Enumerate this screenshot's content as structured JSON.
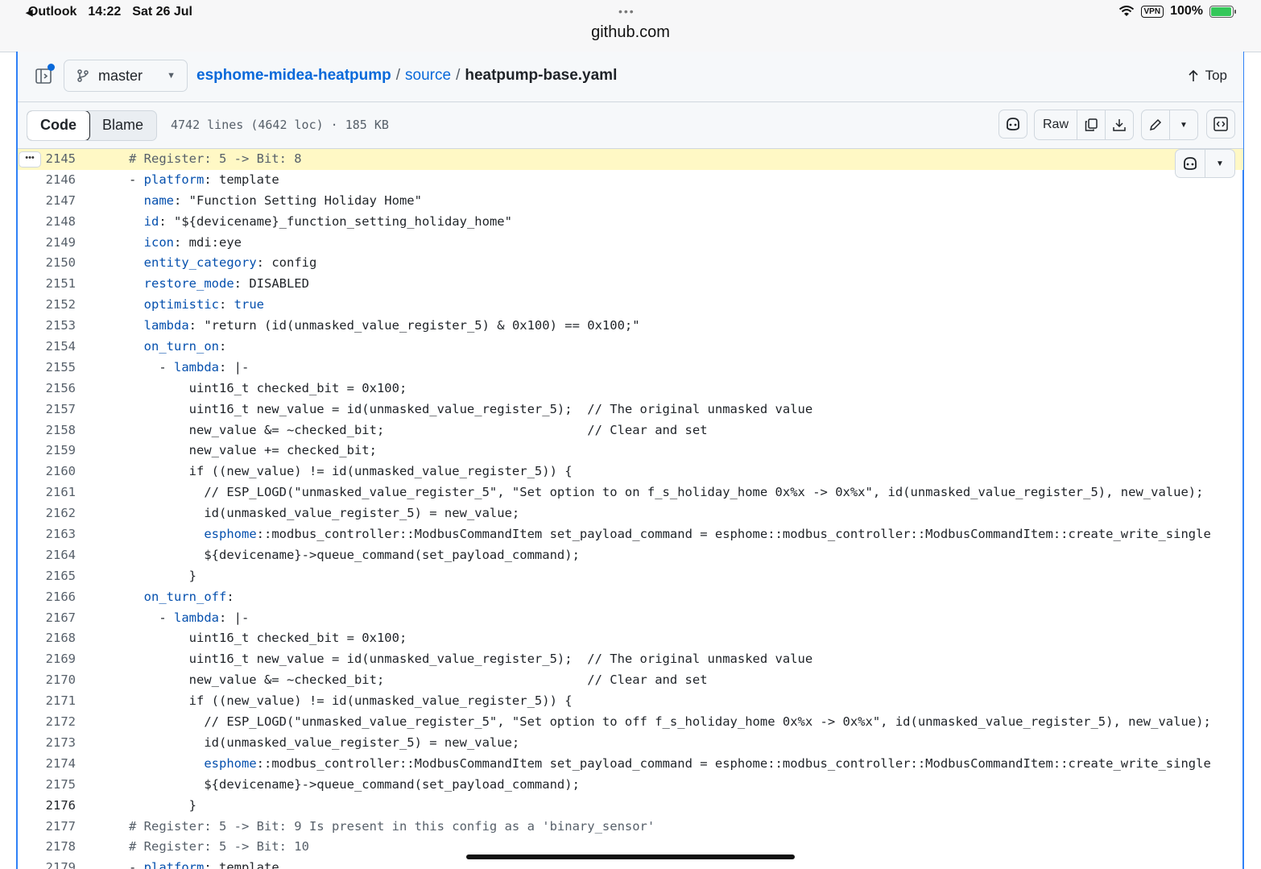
{
  "status_bar": {
    "back_app": "Outlook",
    "time": "14:22",
    "date": "Sat 26 Jul",
    "vpn": "VPN",
    "battery": "100%",
    "url": "github.com"
  },
  "header": {
    "branch": "master",
    "repo": "esphome-midea-heatpump",
    "folder": "source",
    "file": "heatpump-base.yaml",
    "top_label": "Top"
  },
  "toolbar": {
    "tab_code": "Code",
    "tab_blame": "Blame",
    "file_info": "4742 lines (4642 loc) · 185 KB",
    "raw_label": "Raw"
  },
  "code_lines": [
    {
      "n": "2145",
      "t": "# Register: 5 -> Bit: 8"
    },
    {
      "n": "2146",
      "t": "- platform: template"
    },
    {
      "n": "2147",
      "t": "  name: \"Function Setting Holiday Home\""
    },
    {
      "n": "2148",
      "t": "  id: \"${devicename}_function_setting_holiday_home\""
    },
    {
      "n": "2149",
      "t": "  icon: mdi:eye"
    },
    {
      "n": "2150",
      "t": "  entity_category: config"
    },
    {
      "n": "2151",
      "t": "  restore_mode: DISABLED"
    },
    {
      "n": "2152",
      "t": "  optimistic: true"
    },
    {
      "n": "2153",
      "t": "  lambda: \"return (id(unmasked_value_register_5) & 0x100) == 0x100;\""
    },
    {
      "n": "2154",
      "t": "  on_turn_on:"
    },
    {
      "n": "2155",
      "t": "    - lambda: |-"
    },
    {
      "n": "2156",
      "t": "        uint16_t checked_bit = 0x100;"
    },
    {
      "n": "2157",
      "t": "        uint16_t new_value = id(unmasked_value_register_5);  // The original unmasked value"
    },
    {
      "n": "2158",
      "t": "        new_value &= ~checked_bit;                           // Clear and set"
    },
    {
      "n": "2159",
      "t": "        new_value += checked_bit;"
    },
    {
      "n": "2160",
      "t": "        if ((new_value) != id(unmasked_value_register_5)) {"
    },
    {
      "n": "2161",
      "t": "          // ESP_LOGD(\"unmasked_value_register_5\", \"Set option to on f_s_holiday_home 0x%x -> 0x%x\", id(unmasked_value_register_5), new_value);"
    },
    {
      "n": "2162",
      "t": "          id(unmasked_value_register_5) = new_value;"
    },
    {
      "n": "2163",
      "t": "          esphome::modbus_controller::ModbusCommandItem set_payload_command = esphome::modbus_controller::ModbusCommandItem::create_write_single"
    },
    {
      "n": "2164",
      "t": "          ${devicename}->queue_command(set_payload_command);"
    },
    {
      "n": "2165",
      "t": "        }"
    },
    {
      "n": "2166",
      "t": "  on_turn_off:"
    },
    {
      "n": "2167",
      "t": "    - lambda: |-"
    },
    {
      "n": "2168",
      "t": "        uint16_t checked_bit = 0x100;"
    },
    {
      "n": "2169",
      "t": "        uint16_t new_value = id(unmasked_value_register_5);  // The original unmasked value"
    },
    {
      "n": "2170",
      "t": "        new_value &= ~checked_bit;                           // Clear and set"
    },
    {
      "n": "2171",
      "t": "        if ((new_value) != id(unmasked_value_register_5)) {"
    },
    {
      "n": "2172",
      "t": "          // ESP_LOGD(\"unmasked_value_register_5\", \"Set option to off f_s_holiday_home 0x%x -> 0x%x\", id(unmasked_value_register_5), new_value);"
    },
    {
      "n": "2173",
      "t": "          id(unmasked_value_register_5) = new_value;"
    },
    {
      "n": "2174",
      "t": "          esphome::modbus_controller::ModbusCommandItem set_payload_command = esphome::modbus_controller::ModbusCommandItem::create_write_single"
    },
    {
      "n": "2175",
      "t": "          ${devicename}->queue_command(set_payload_command);"
    },
    {
      "n": "2176",
      "t": "        }"
    },
    {
      "n": "2177",
      "t": "# Register: 5 -> Bit: 9 Is present in this config as a 'binary_sensor'"
    },
    {
      "n": "2178",
      "t": "# Register: 5 -> Bit: 10"
    },
    {
      "n": "2179",
      "t": "- platform: template"
    }
  ],
  "highlighted_line": "2145",
  "current_line": "2176",
  "colors": {
    "accent": "#0969da",
    "highlight": "#fff8c5",
    "key": "#0550ae",
    "comment": "#57606a"
  }
}
